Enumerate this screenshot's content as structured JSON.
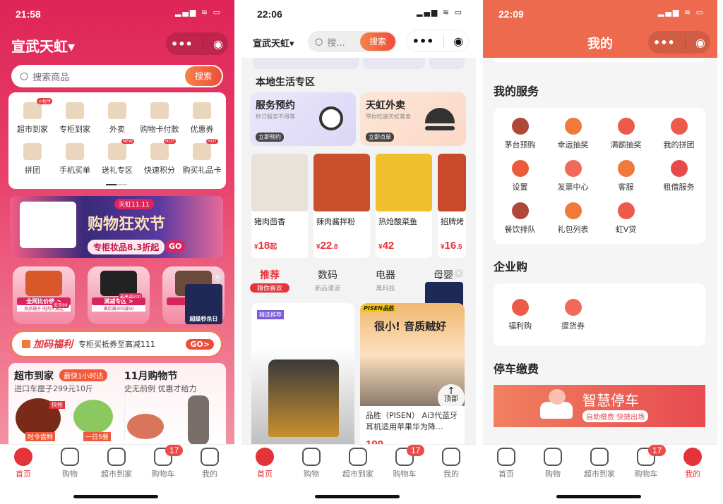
{
  "colors": {
    "accent": "#e5333a",
    "home_bg": "#e0285a",
    "mine_header": "#ee6a4f"
  },
  "tabbar": {
    "items": [
      {
        "label": "首页",
        "icon": "home-icon"
      },
      {
        "label": "购物",
        "icon": "bag-icon"
      },
      {
        "label": "超市到家",
        "icon": "scooter-icon"
      },
      {
        "label": "购物车",
        "icon": "cart-icon"
      },
      {
        "label": "我的",
        "icon": "smile-icon"
      }
    ],
    "cart_badge": "17"
  },
  "capsule": {
    "more": "•••",
    "close": "◉"
  },
  "screen1": {
    "time": "21:58",
    "store": "宣武天虹▾",
    "search_placeholder": "搜索商品",
    "search_button": "搜索",
    "grid": [
      {
        "label": "超市到家",
        "tag": "小程序"
      },
      {
        "label": "专柜到家"
      },
      {
        "label": "外卖"
      },
      {
        "label": "购物卡付款"
      },
      {
        "label": "优惠券"
      },
      {
        "label": "拼团"
      },
      {
        "label": "手机买单"
      },
      {
        "label": "送礼专区",
        "tag": "NEW"
      },
      {
        "label": "快速积分",
        "tag": "HOT"
      },
      {
        "label": "购买礼品卡",
        "tag": "HOT"
      }
    ],
    "banner": {
      "tag": "天虹11.11",
      "title": "购物狂欢节",
      "subtitle": "专柜妆品8.3折起",
      "go": "GO"
    },
    "promos": [
      {
        "title": "全网比价榜 >",
        "sub": "良品铺子 肉肉大满足",
        "note": "低至99"
      },
      {
        "title": "满减专区 >",
        "sub": "满店满300减50",
        "note": "最高减200"
      },
      {
        "title": "专柜 >",
        "sub": ""
      }
    ],
    "float_ad": "超级秒杀日",
    "bonus": {
      "title": "加码福利",
      "text": "专柜买抵券至高减111",
      "go": "GO>"
    },
    "market": {
      "title": "超市到家",
      "tag": "最快1小时达",
      "sub": "进口车厘子299元10斤",
      "labels": [
        "时令尝鲜",
        "一日5餐"
      ],
      "hot": "快抢"
    },
    "festival": {
      "title": "11月购物节",
      "sub": "史无前例 优惠才给力"
    }
  },
  "screen2": {
    "time": "22:06",
    "store": "宣武天虹▾",
    "search_placeholder": "搜...",
    "search_button": "搜索",
    "section": "本地生活专区",
    "services": [
      {
        "title": "服务预约",
        "sub": "秒订服务不用等",
        "btn": "立即预约"
      },
      {
        "title": "天虹外卖",
        "sub": "带你吃遍天虹美食",
        "btn": "立即点单"
      }
    ],
    "foods": [
      {
        "name": "猪肉茴香",
        "price": "18",
        "suffix": "起"
      },
      {
        "name": "辣肉酱拌粉",
        "price": "22",
        "suffix": ".8"
      },
      {
        "name": "热炝酸菜鱼",
        "price": "42",
        "suffix": ""
      },
      {
        "name": "招牌烤",
        "price": "16",
        "suffix": ".5"
      }
    ],
    "categories": [
      {
        "title": "推荐",
        "sub": "猜你喜欢"
      },
      {
        "title": "数码",
        "sub": "新品速递"
      },
      {
        "title": "电器",
        "sub": "黑科技"
      },
      {
        "title": "母婴",
        "sub": ""
      }
    ],
    "float_ad": "超级秒杀日",
    "left_card_tag": "精选推荐",
    "right_card": {
      "brand": "PISEN品胜",
      "headline": "很小! 音质贼好",
      "title": "品胜（PISEN） Ai3代蓝牙耳机适用苹果华为降...",
      "price": "199"
    },
    "top_button": "顶部"
  },
  "screen3": {
    "time": "22:09",
    "title": "我的",
    "services_title": "我的服务",
    "services": [
      {
        "label": "茅台预购"
      },
      {
        "label": "幸运抽奖"
      },
      {
        "label": "满额抽奖"
      },
      {
        "label": "我的拼团"
      },
      {
        "label": "设置"
      },
      {
        "label": "发票中心"
      },
      {
        "label": "客服"
      },
      {
        "label": "租借服务"
      },
      {
        "label": "餐饮排队"
      },
      {
        "label": "礼包列表"
      },
      {
        "label": "虹V贷"
      }
    ],
    "enterprise_title": "企业购",
    "enterprise": [
      {
        "label": "福利购"
      },
      {
        "label": "提货券"
      }
    ],
    "parking_title": "停车缴费",
    "parking": {
      "title": "智慧停车",
      "sub": "自助缴费 快捷出场"
    }
  }
}
